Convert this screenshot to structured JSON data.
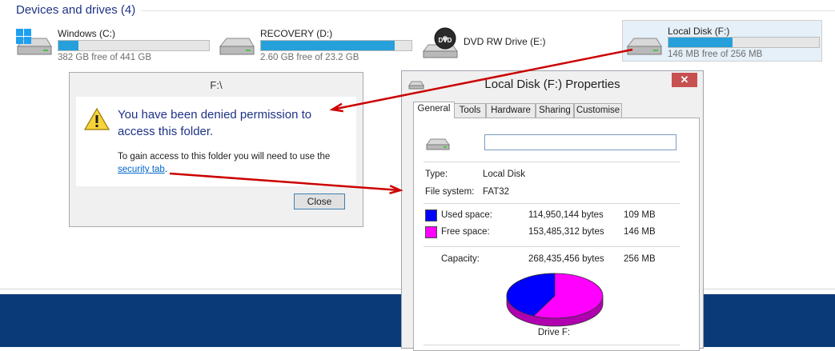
{
  "explorer": {
    "section_title": "Devices and drives (4)",
    "drives": [
      {
        "name": "Windows (C:)",
        "free_text": "382 GB free of 441 GB",
        "used_fraction": 0.134,
        "icon": "windows-drive-icon"
      },
      {
        "name": "RECOVERY (D:)",
        "free_text": "2.60 GB free of 23.2 GB",
        "used_fraction": 0.888,
        "icon": "hard-drive-icon"
      },
      {
        "name": "DVD RW Drive (E:)",
        "free_text": "",
        "icon": "dvd-drive-icon",
        "icon_label": "DVD"
      },
      {
        "name": "Local Disk (F:)",
        "free_text": "146 MB free of 256 MB",
        "used_fraction": 0.428,
        "icon": "hard-drive-icon",
        "selected": true
      }
    ]
  },
  "deny_dialog": {
    "title": "F:\\",
    "message": "You have been denied permission to access this folder.",
    "hint_prefix": "To gain access to this folder you will need to use the ",
    "hint_link": "security tab",
    "hint_suffix": ".",
    "close_label": "Close",
    "icon": "warning-icon"
  },
  "properties_dialog": {
    "title": "Local Disk (F:) Properties",
    "close_glyph": "✕",
    "tabs": [
      "General",
      "Tools",
      "Hardware",
      "Sharing",
      "Customise"
    ],
    "active_tab": "General",
    "drive_name_value": "",
    "type_label": "Type:",
    "type_value": "Local Disk",
    "fs_label": "File system:",
    "fs_value": "FAT32",
    "used": {
      "label": "Used space:",
      "bytes": "114,950,144 bytes",
      "size": "109 MB",
      "color": "#0000ff"
    },
    "free": {
      "label": "Free space:",
      "bytes": "153,485,312 bytes",
      "size": "146 MB",
      "color": "#ff00ff"
    },
    "capacity": {
      "label": "Capacity:",
      "bytes": "268,435,456 bytes",
      "size": "256 MB"
    },
    "pie_used_fraction": 0.428,
    "drive_caption": "Drive F:"
  },
  "colors": {
    "accent_title": "#1e3287",
    "bar_fill": "#26a0da",
    "band": "#0b3a78",
    "arrow": "#cc0000"
  }
}
